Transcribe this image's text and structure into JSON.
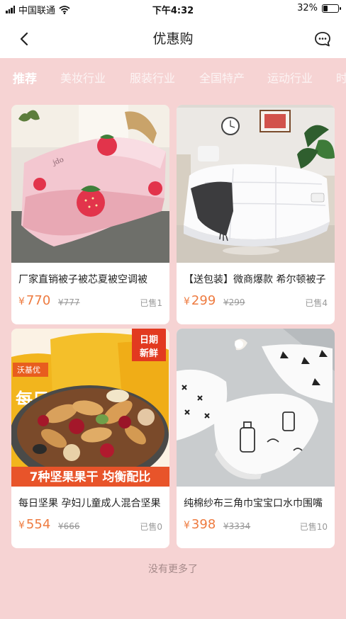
{
  "status": {
    "carrier": "中国联通",
    "time": "下午4:32",
    "battery": "32%",
    "battery_level": 0.32
  },
  "nav": {
    "title": "优惠购"
  },
  "tabs": [
    "推荐",
    "美妆行业",
    "服装行业",
    "全国特产",
    "运动行业",
    "时"
  ],
  "products": [
    {
      "title": "厂家直销被子被芯夏被空调被",
      "price": "770",
      "orig_price": "777",
      "sold": "已售1"
    },
    {
      "title": "【送包装】微商爆款 希尔顿被子",
      "price": "299",
      "orig_price": "299",
      "sold": "已售4"
    },
    {
      "title": "每日坚果 孕妇儿童成人混合坚果",
      "price": "554",
      "orig_price": "666",
      "sold": "已售0",
      "banner_text": "7种坚果果干 均衡配比",
      "badge_text": "日期新鲜",
      "pack_text": "每日"
    },
    {
      "title": "纯棉纱布三角巾宝宝口水巾围嘴",
      "price": "398",
      "orig_price": "3334",
      "sold": "已售10"
    }
  ],
  "currency": "¥",
  "footer": {
    "no_more": "没有更多了"
  },
  "colors": {
    "page_bg": "#f6d3d3",
    "price": "#ee7b40",
    "text": "#222222"
  }
}
